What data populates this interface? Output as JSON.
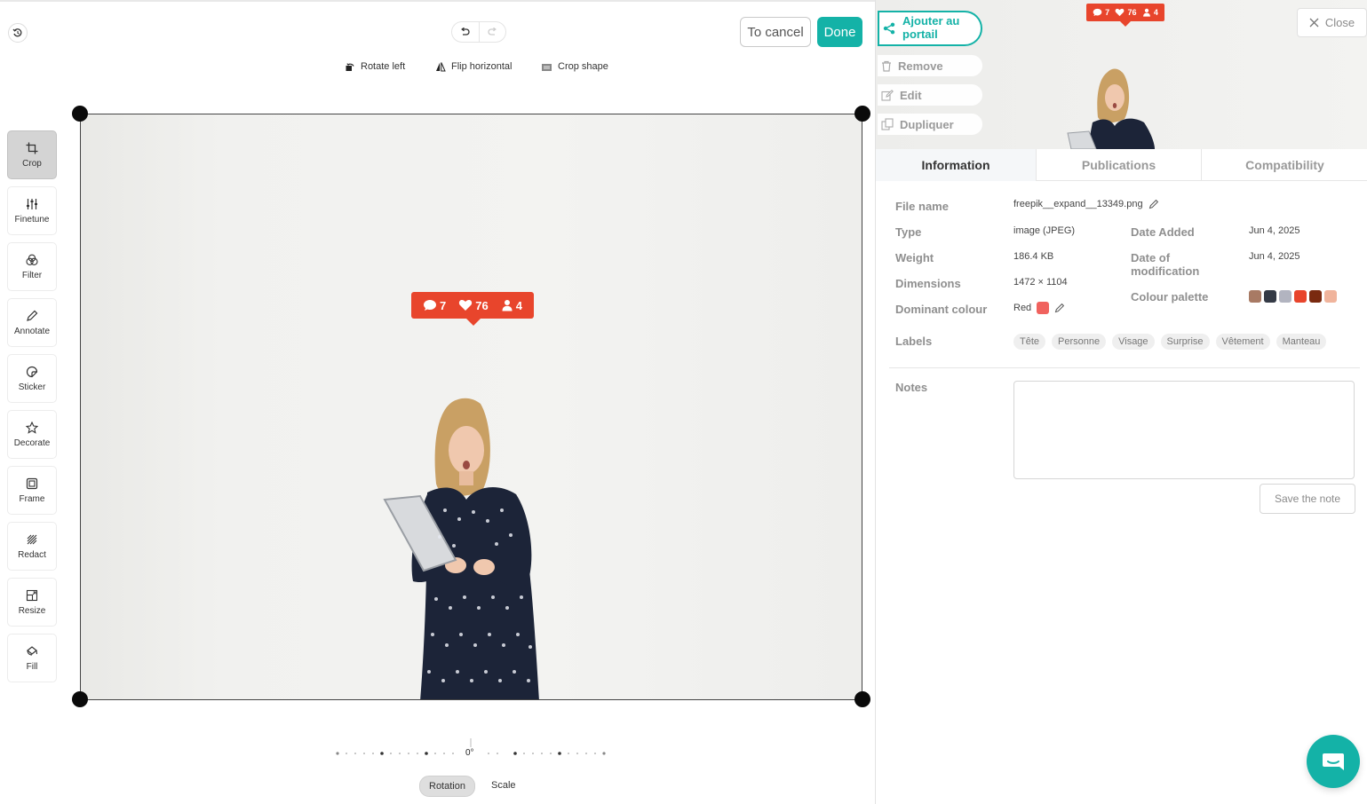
{
  "editor": {
    "undo_label": "Undo",
    "redo_label": "Redo",
    "cancel_label": "To cancel",
    "done_label": "Done",
    "tool_options": {
      "rotate_left": "Rotate left",
      "flip_horizontal": "Flip horizontal",
      "crop_shape": "Crop shape"
    },
    "tools": [
      {
        "label": "Crop",
        "icon": "crop-icon",
        "active": true
      },
      {
        "label": "Finetune",
        "icon": "sliders-icon"
      },
      {
        "label": "Filter",
        "icon": "filter-icon"
      },
      {
        "label": "Annotate",
        "icon": "pencil-icon"
      },
      {
        "label": "Sticker",
        "icon": "sticker-icon"
      },
      {
        "label": "Decorate",
        "icon": "star-icon"
      },
      {
        "label": "Frame",
        "icon": "frame-icon"
      },
      {
        "label": "Redact",
        "icon": "redact-icon"
      },
      {
        "label": "Resize",
        "icon": "resize-icon"
      },
      {
        "label": "Fill",
        "icon": "fill-icon"
      }
    ],
    "image_notification": {
      "comments": "7",
      "likes": "76",
      "followers": "4"
    },
    "rotation_value": "0°",
    "modes": {
      "rotation": "Rotation",
      "scale": "Scale"
    }
  },
  "panel": {
    "actions": {
      "portal": "Ajouter au portail",
      "remove": "Remove",
      "edit": "Edit",
      "duplicate": "Dupliquer",
      "close": "Close"
    },
    "preview_notification": {
      "comments": "7",
      "likes": "76",
      "followers": "4"
    },
    "tabs": [
      "Information",
      "Publications",
      "Compatibility"
    ],
    "info": {
      "file_name_label": "File name",
      "file_name": "freepik__expand__13349.png",
      "type_label": "Type",
      "type": "image (JPEG)",
      "weight_label": "Weight",
      "weight": "186.4 KB",
      "dimensions_label": "Dimensions",
      "dimensions": "1472 × 1104",
      "dominant_colour_label": "Dominant colour",
      "dominant_colour": "Red",
      "dominant_colour_hex": "#f0625e",
      "date_added_label": "Date Added",
      "date_added": "Jun 4, 2025",
      "date_modified_label": "Date of modification",
      "date_modified": "Jun 4, 2025",
      "palette_label": "Colour palette",
      "palette": [
        "#a87a64",
        "#343a46",
        "#b2b4c0",
        "#e8452c",
        "#7a2a10",
        "#f0b49c"
      ],
      "labels_label": "Labels",
      "labels": [
        "Tête",
        "Personne",
        "Visage",
        "Surprise",
        "Vêtement",
        "Manteau"
      ]
    },
    "notes": {
      "label": "Notes",
      "value": "",
      "save_label": "Save the note"
    }
  },
  "colors": {
    "accent": "#14b2a7",
    "notification": "#e8452c"
  }
}
